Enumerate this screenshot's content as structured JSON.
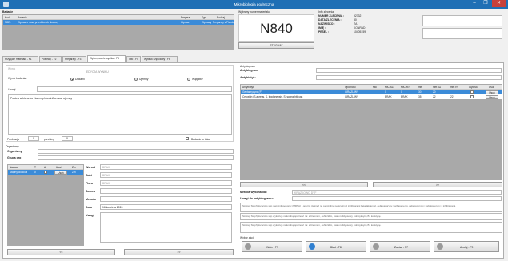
{
  "window": {
    "title": "Mikrobiologia podręczna",
    "minimize": "–",
    "maximize": "❐",
    "close": "✕"
  },
  "badania": {
    "label": "Badanie",
    "columns": [
      "Kod",
      "Badanie",
      "Preparat",
      "Typ",
      "Rodzaj"
    ],
    "rows": [
      [
        "N821",
        "Wymaz z nosa przedsionek Nosowy",
        "Wymaz",
        "Wymazy",
        "Preparaty z Fizjologii"
      ]
    ]
  },
  "probka": {
    "label": "Wybrany numer materiału",
    "number": "N840",
    "stygmat": "STYGMAT"
  },
  "info": {
    "label": "Info zlecenia",
    "rows": [
      {
        "k": "NUMER ZLECENIA :",
        "v": "92732"
      },
      {
        "k": "DATA ZLECENIA :",
        "v": "30"
      },
      {
        "k": "NAZWISKO :",
        "v": "ZA"
      },
      {
        "k": "IMIĘ :",
        "v": "KONRAD"
      },
      {
        "k": "PESEL :",
        "v": "10405159"
      }
    ]
  },
  "tabs": [
    "Przyjęcie materiału - F1",
    "Posiewy - F2",
    "Preparaty - F3",
    "Wykonywanie wyniku - F4",
    "Info - F5",
    "Wydruk częściowy - F6"
  ],
  "wynik": {
    "group_label": "Wynik",
    "edycja": "EDYCJA WYNIKU",
    "wynik_badania": "Wynik badania :",
    "options": [
      "Dodatni",
      "Ujemny",
      "Wątpliwy"
    ],
    "uwagi": "Uwagi",
    "opis": "Posiew w kierunku Haemophilus influenzae ujemny",
    "punktacja": "Punktacja",
    "punktacja_val": "0",
    "przebieg": "przebieg",
    "przebieg_val": "0",
    "w_toku": "Badanie w toku"
  },
  "organizmy": {
    "label": "Organizmy",
    "organizmy": "Organizmy",
    "grupa": "Grupa org",
    "columns": [
      "Nazwa",
      "T",
      "A",
      "Usuń",
      "Zm"
    ],
    "rows": [
      [
        "Staphylococcus",
        "0",
        "",
        "Usuń",
        "Zm"
      ]
    ],
    "fields": [
      {
        "k": "Wzrost",
        "v": "BRAK"
      },
      {
        "k": "Bakt",
        "v": "BRAK"
      },
      {
        "k": "Flora",
        "v": "BRAK"
      },
      {
        "k": "Szczep",
        "v": ""
      },
      {
        "k": "Metoda",
        "v": ""
      },
      {
        "k": "Data",
        "v": "16 kwietnia 2013"
      },
      {
        "k": "Uwagi",
        "v": ""
      }
    ],
    "prev": "<<",
    "next": ">>"
  },
  "antybiogram": {
    "label": "Antybiogram",
    "antybiogram": "Antybiogram:",
    "antybiotyk": "Antybiotyk:",
    "columns": [
      "Antybiotyk",
      "Oporność",
      "Mic",
      "MIC S≤",
      "MIC R>",
      "mm",
      "mm S≥",
      "mm R<",
      "Wydruk",
      "Usuń"
    ],
    "rows": [
      [
        "Gentamycyna (F)",
        "WRAŻLIWY",
        "",
        "0",
        "0",
        "30",
        "20",
        "",
        "",
        "Usuń"
      ],
      [
        "Cefoxitin (S.aureus, S. lugdunensis, S. saprophiticus)",
        "WRAŻLIWY",
        "",
        "BRAK",
        "BRAK",
        "35",
        "22",
        "22",
        "",
        "Usuń"
      ]
    ],
    "prev": "<<",
    "next": ">>",
    "metoda_label": "Metoda wykonania :",
    "metoda_val": "KRĄŻKOWO DYF",
    "uwagi_label": "Uwagi do antybiogramu:",
    "note1": "Szczep Staphylococcus spp metycylinooporny (MRSA) - oporny również na penicyliny, penicyliny z inhibitorami beta-laktamaz, cefalosporyny, karbapenemy, cefalosporyny i cefalosporyny z inhibitorami.",
    "note2": "Szczep Staphylococcus spp wykazuje naturalną oporność na: aztreonam, ceftazidim, kwas nalidyksowy, polimyksynę B i kolistynę.",
    "note3": "Szczep Staphylococcus spp wykazuje naturalną oporność na: aztreonam, ceftazidim, kwas nalidyksowy, polimyksynę B i kolistynę."
  },
  "akcje": {
    "label": "Wybór akcji",
    "buttons": [
      {
        "label": "Wzór - F9",
        "color": "#9a9a9a"
      },
      {
        "label": "Błąd - F8",
        "color": "#2f7fd0"
      },
      {
        "label": "Zapisz - F7",
        "color": "#9a9a9a"
      },
      {
        "label": "Anuluj - F9",
        "color": "#9a9a9a"
      }
    ]
  }
}
